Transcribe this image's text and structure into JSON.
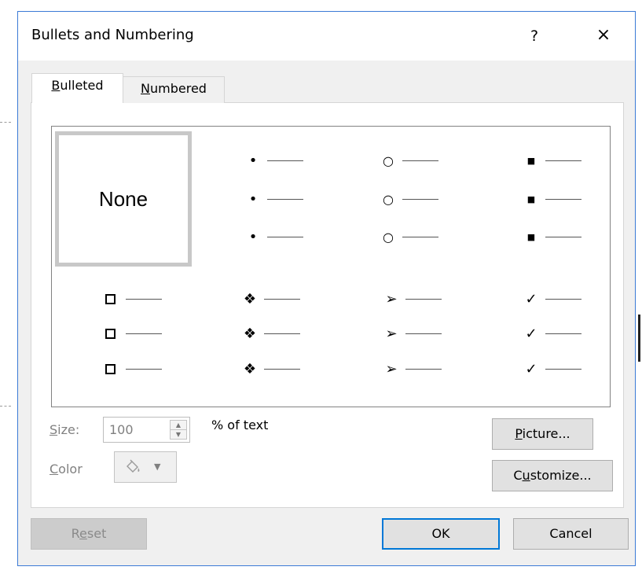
{
  "dialog": {
    "title": "Bullets and Numbering",
    "help_label": "?",
    "close_label": "×"
  },
  "tabs": [
    {
      "label_ul": "B",
      "label_rest": "ulleted",
      "active": true
    },
    {
      "label_ul": "N",
      "label_rest": "umbered",
      "active": false
    }
  ],
  "gallery": {
    "none_label": "None",
    "styles": [
      {
        "name": "disc",
        "glyph": "•"
      },
      {
        "name": "circle",
        "glyph": "○"
      },
      {
        "name": "square",
        "glyph": "■"
      },
      {
        "name": "hollow-square",
        "glyph": ""
      },
      {
        "name": "four-diamonds",
        "glyph": "❖"
      },
      {
        "name": "arrowhead",
        "glyph": "➢"
      },
      {
        "name": "checkmark",
        "glyph": "✓"
      }
    ]
  },
  "size": {
    "label_ul": "S",
    "label_rest": "ize:",
    "value": "100",
    "suffix": "% of text",
    "spin_up": "▲",
    "spin_down": "▼"
  },
  "color": {
    "label_ul": "C",
    "label_rest": "olor",
    "icon": "paint-bucket-icon",
    "arrow": "▼"
  },
  "buttons": {
    "picture": {
      "ul": "P",
      "rest": "icture..."
    },
    "customize": {
      "pre": "C",
      "ul": "u",
      "rest": "stomize..."
    },
    "reset": {
      "pre": "R",
      "ul": "e",
      "rest": "set"
    },
    "ok": "OK",
    "cancel": "Cancel"
  },
  "colors": {
    "accent": "#0078d7",
    "dialog_border": "#3b7ad6",
    "selected_border": "#c8c8c8"
  }
}
